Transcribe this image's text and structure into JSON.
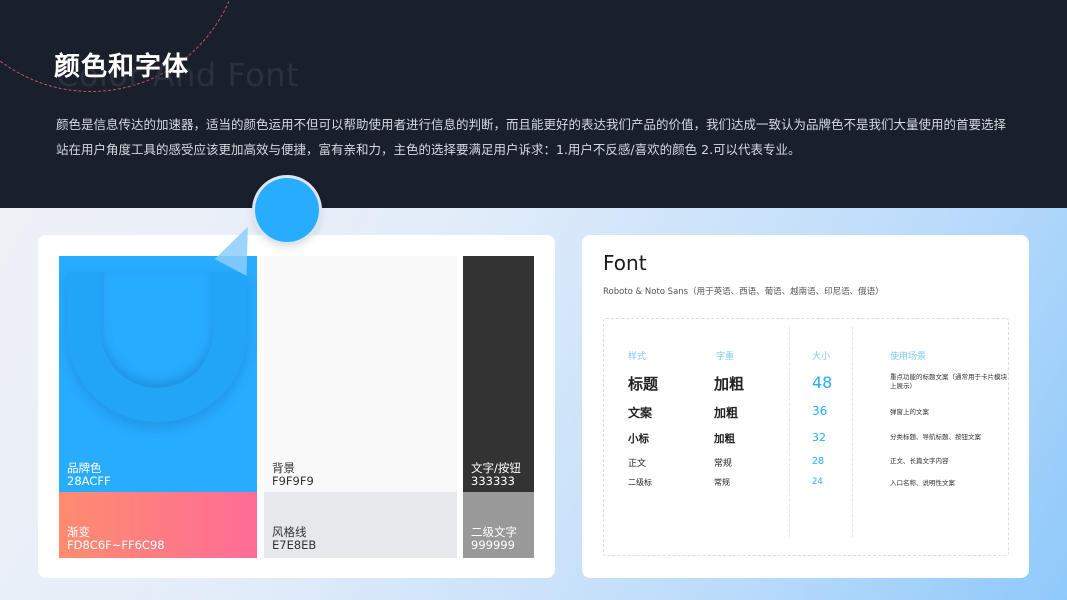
{
  "header": {
    "title": "颜色和字体",
    "ghost_title": "Color And Font",
    "description": "颜色是信息传达的加速器，适当的颜色运用不但可以帮助使用者进行信息的判断，而且能更好的表达我们产品的价值，我们达成一致认为品牌色不是我们大量使用的首要选择站在用户角度工具的感受应该更加高效与便捷，富有亲和力，主色的选择要满足用户诉求：1.用户不反感/喜欢的颜色 2.可以代表专业。"
  },
  "colors": {
    "brand": {
      "name": "品牌色",
      "hex": "28ACFF",
      "color": "#28acff"
    },
    "gradient": {
      "name": "渐变",
      "hex": "FD8C6F~FF6C98",
      "color_from": "#fd8c6f",
      "color_to": "#ff6c98"
    },
    "background": {
      "name": "背景",
      "hex": "F9F9F9",
      "color": "#f9f9f9"
    },
    "line": {
      "name": "风格线",
      "hex": "E7E8EB",
      "color": "#e7e8eb"
    },
    "text": {
      "name": "文字/按钮",
      "hex": "333333",
      "color": "#333333"
    },
    "text2": {
      "name": "二级文字",
      "hex": "999999",
      "color": "#999999"
    }
  },
  "font": {
    "title": "Font",
    "subtitle": "Roboto & Noto Sans（用于英语、西语、葡语、越南语、印尼语、俄语）",
    "headers": {
      "style": "样式",
      "weight": "字重",
      "size": "大小",
      "usage": "使用场景"
    },
    "rows": [
      {
        "style": "标题",
        "weight": "加粗",
        "size": "48",
        "usage": "重点功能的标题文案（通常用于卡片模块上展示）"
      },
      {
        "style": "文案",
        "weight": "加粗",
        "size": "36",
        "usage": "弹窗上的文案"
      },
      {
        "style": "小标",
        "weight": "加粗",
        "size": "32",
        "usage": "分类标题、导航标题、按钮文案"
      },
      {
        "style": "正文",
        "weight": "常规",
        "size": "28",
        "usage": "正文、长篇文字内容"
      },
      {
        "style": "二级标",
        "weight": "常规",
        "size": "24",
        "usage": "入口名称、说明性文案"
      }
    ]
  }
}
